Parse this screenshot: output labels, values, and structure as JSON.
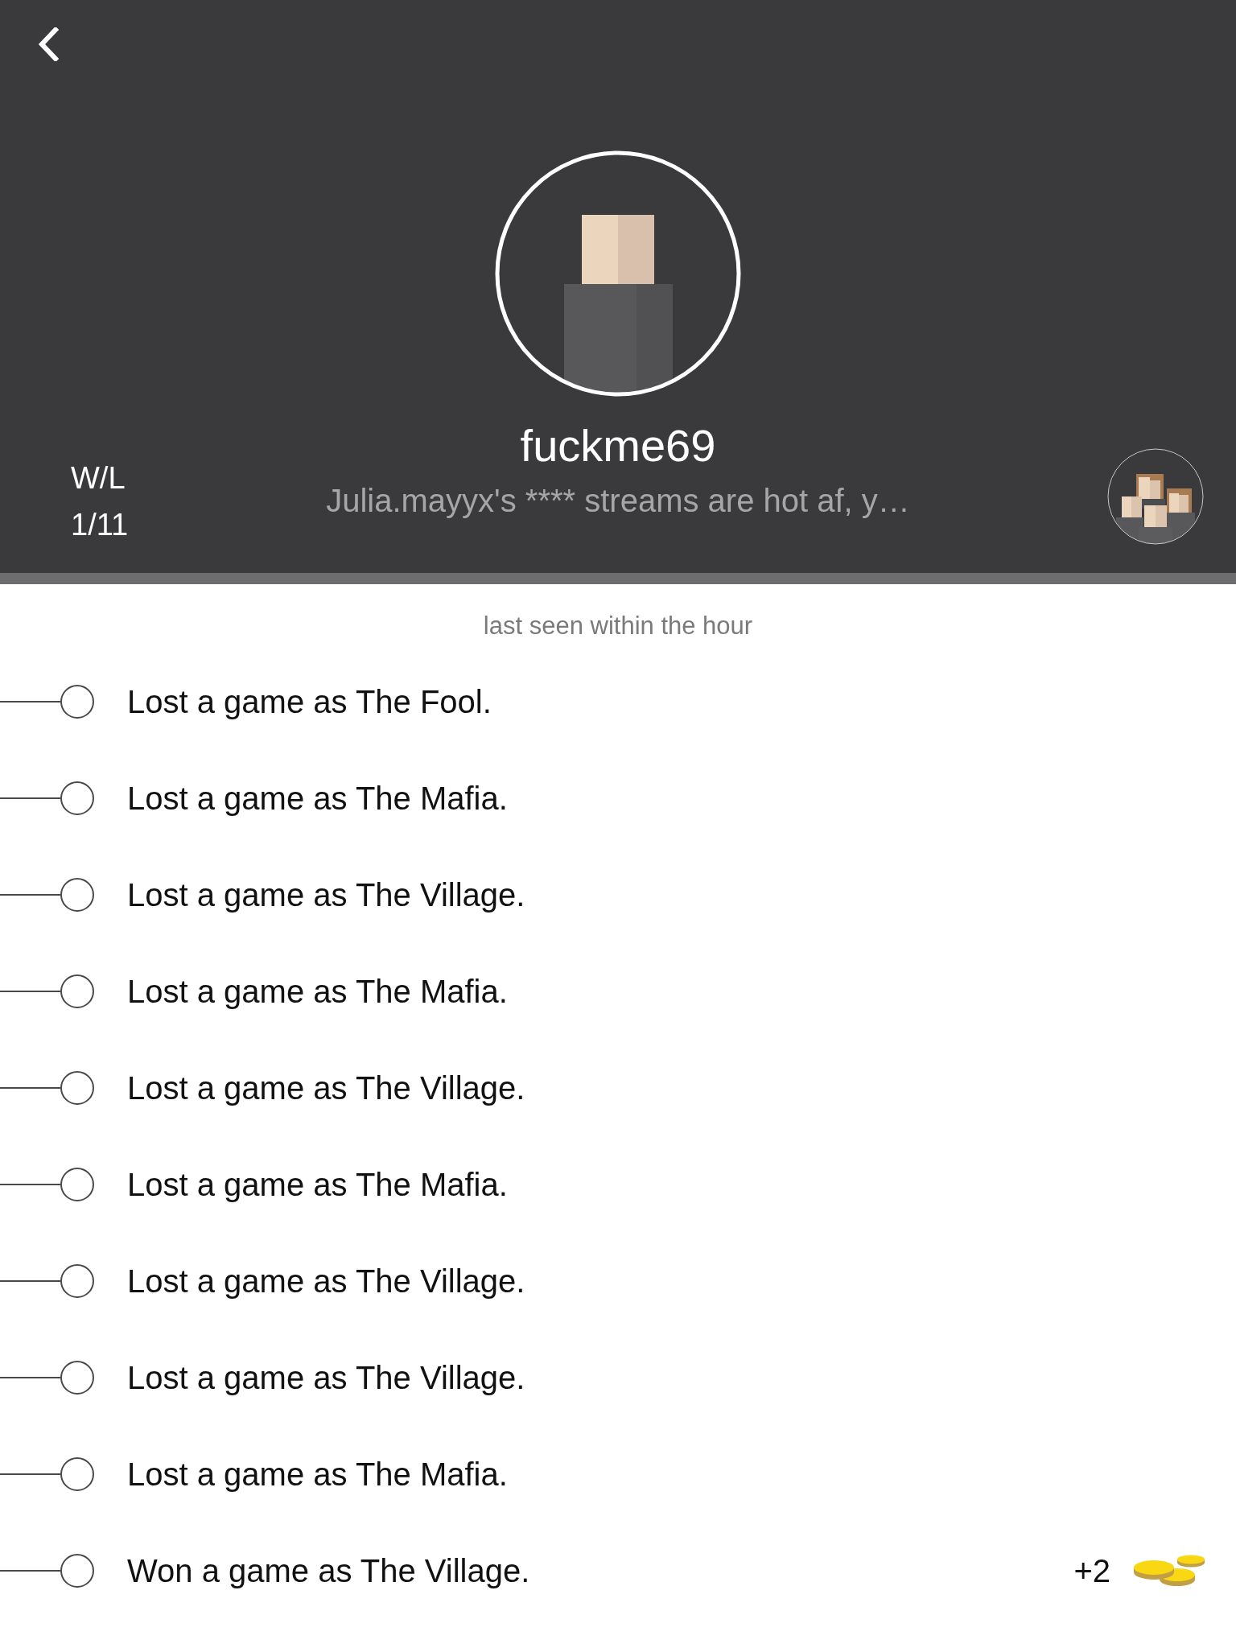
{
  "profile": {
    "username": "fuckme69",
    "status": "Julia.mayyx's **** streams are hot af, y…",
    "record_label": "W/L",
    "record": "1/11"
  },
  "last_seen": "last seen within the hour",
  "history": [
    {
      "text": "Lost a game as The Fool."
    },
    {
      "text": "Lost a game as The Mafia."
    },
    {
      "text": "Lost a game as The Village."
    },
    {
      "text": "Lost a game as The Mafia."
    },
    {
      "text": "Lost a game as The Village."
    },
    {
      "text": "Lost a game as The Mafia."
    },
    {
      "text": "Lost a game as The Village."
    },
    {
      "text": "Lost a game as The Village."
    },
    {
      "text": "Lost a game as The Mafia."
    },
    {
      "text": "Won a game as The Village.",
      "reward": "+2"
    }
  ]
}
